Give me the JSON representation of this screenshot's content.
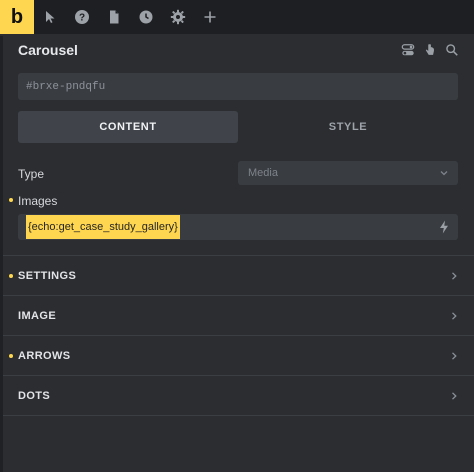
{
  "toolbar": {
    "logo_letter": "b",
    "tools": [
      {
        "name": "cursor-icon"
      },
      {
        "name": "help-icon"
      },
      {
        "name": "page-icon"
      },
      {
        "name": "history-icon"
      },
      {
        "name": "settings-gear-icon"
      },
      {
        "name": "add-icon"
      }
    ]
  },
  "panel": {
    "title": "Carousel",
    "actions": [
      "toggle-icon",
      "cursor-hand-icon",
      "search-icon"
    ]
  },
  "id_field": {
    "value": "#brxe-pndqfu"
  },
  "tabs": [
    {
      "label": "CONTENT",
      "active": true
    },
    {
      "label": "STYLE",
      "active": false
    }
  ],
  "controls": {
    "type": {
      "label": "Type",
      "value": "Media"
    },
    "images": {
      "label": "Images",
      "value": "{echo:get_case_study_gallery}"
    }
  },
  "sections": [
    {
      "label": "SETTINGS",
      "modified": true
    },
    {
      "label": "IMAGE",
      "modified": false
    },
    {
      "label": "ARROWS",
      "modified": true
    },
    {
      "label": "DOTS",
      "modified": false
    }
  ],
  "colors": {
    "accent": "#ffd64f",
    "panel_bg": "#2b2d31",
    "toolbar_bg": "#1d1f22",
    "input_bg": "#393c41"
  }
}
